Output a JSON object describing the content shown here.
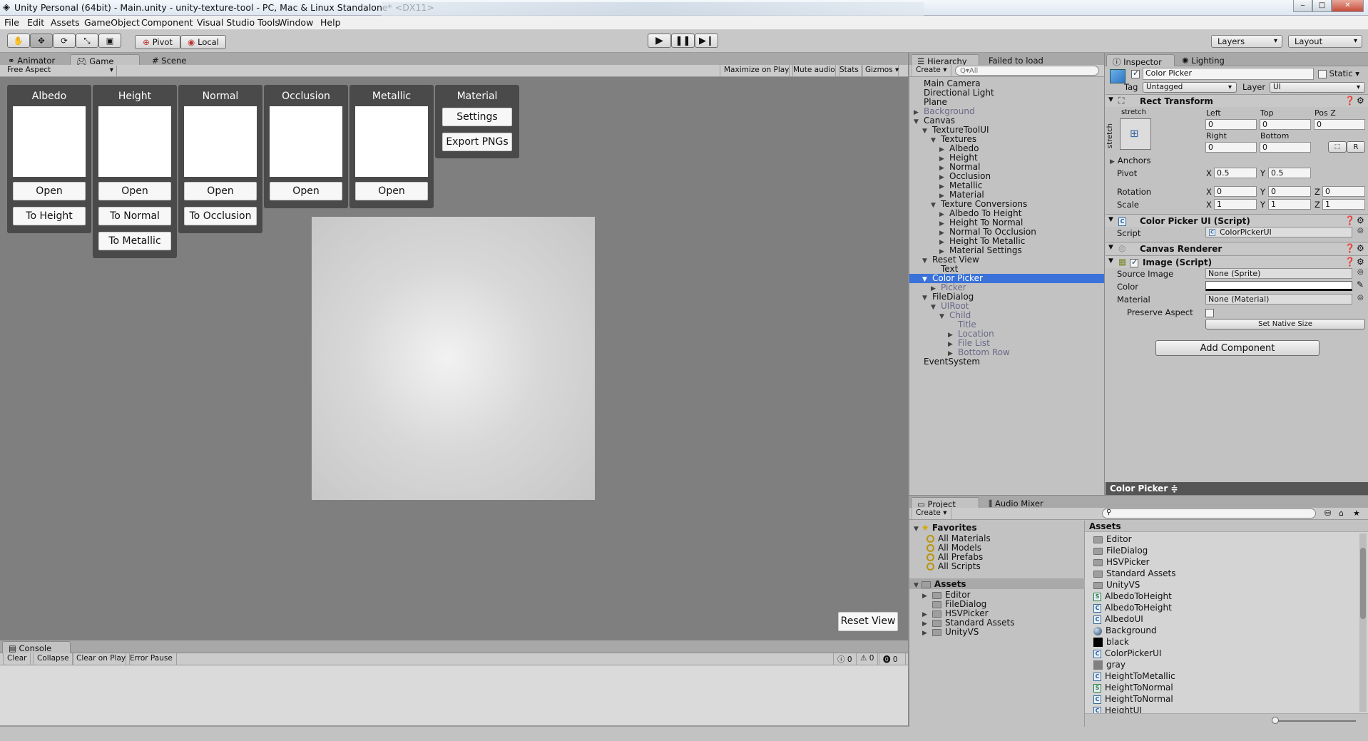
{
  "window": {
    "title": "Unity Personal (64bit) - Main.unity - unity-texture-tool - PC, Mac & Linux Standalone* <DX11>",
    "controls": [
      "‒",
      "□",
      "✕"
    ]
  },
  "menu": [
    "File",
    "Edit",
    "Assets",
    "GameObject",
    "Component",
    "Visual Studio Tools",
    "Window",
    "Help"
  ],
  "toolbar": {
    "pivot_label": "Pivot",
    "local_label": "Local",
    "layers_label": "Layers",
    "layout_label": "Layout"
  },
  "left_tabs": [
    "Animator",
    "Game",
    "Scene"
  ],
  "game_bar": {
    "aspect": "Free Aspect",
    "buttons": [
      "Maximize on Play",
      "Mute audio",
      "Stats",
      "Gizmos"
    ]
  },
  "game": {
    "panels": [
      {
        "label": "Albedo",
        "buttons": [
          "Open",
          "To Height"
        ]
      },
      {
        "label": "Height",
        "buttons": [
          "Open",
          "To Normal",
          "To Metallic"
        ]
      },
      {
        "label": "Normal",
        "buttons": [
          "Open",
          "To Occlusion"
        ]
      },
      {
        "label": "Occlusion",
        "buttons": [
          "Open"
        ]
      },
      {
        "label": "Metallic",
        "buttons": [
          "Open"
        ]
      },
      {
        "label": "Material",
        "buttons": [
          "Settings",
          "Export PNGs"
        ]
      }
    ],
    "reset_view": "Reset View"
  },
  "console": {
    "tab": "Console",
    "buttons": [
      "Clear",
      "Collapse",
      "Clear on Play",
      "Error Pause"
    ],
    "counts": [
      "0",
      "0",
      "0"
    ]
  },
  "hierarchy": {
    "tabs": [
      "Hierarchy",
      "Failed to load"
    ],
    "create": "Create",
    "search_placeholder": "Q▾All",
    "items": [
      {
        "label": "Main Camera",
        "depth": 0,
        "arrow": "",
        "dim": false
      },
      {
        "label": "Directional Light",
        "depth": 0,
        "arrow": "",
        "dim": false
      },
      {
        "label": "Plane",
        "depth": 0,
        "arrow": "",
        "dim": false
      },
      {
        "label": "Background",
        "depth": 0,
        "arrow": "▶",
        "dim": true
      },
      {
        "label": "Canvas",
        "depth": 0,
        "arrow": "▼",
        "dim": false
      },
      {
        "label": "TextureToolUI",
        "depth": 1,
        "arrow": "▼",
        "dim": false
      },
      {
        "label": "Textures",
        "depth": 2,
        "arrow": "▼",
        "dim": false
      },
      {
        "label": "Albedo",
        "depth": 3,
        "arrow": "▶",
        "dim": false
      },
      {
        "label": "Height",
        "depth": 3,
        "arrow": "▶",
        "dim": false
      },
      {
        "label": "Normal",
        "depth": 3,
        "arrow": "▶",
        "dim": false
      },
      {
        "label": "Occlusion",
        "depth": 3,
        "arrow": "▶",
        "dim": false
      },
      {
        "label": "Metallic",
        "depth": 3,
        "arrow": "▶",
        "dim": false
      },
      {
        "label": "Material",
        "depth": 3,
        "arrow": "▶",
        "dim": false
      },
      {
        "label": "Texture Conversions",
        "depth": 2,
        "arrow": "▼",
        "dim": false
      },
      {
        "label": "Albedo To Height",
        "depth": 3,
        "arrow": "▶",
        "dim": false
      },
      {
        "label": "Height To Normal",
        "depth": 3,
        "arrow": "▶",
        "dim": false
      },
      {
        "label": "Normal To Occlusion",
        "depth": 3,
        "arrow": "▶",
        "dim": false
      },
      {
        "label": "Height To Metallic",
        "depth": 3,
        "arrow": "▶",
        "dim": false
      },
      {
        "label": "Material Settings",
        "depth": 3,
        "arrow": "▶",
        "dim": false
      },
      {
        "label": "Reset View",
        "depth": 1,
        "arrow": "▼",
        "dim": false
      },
      {
        "label": "Text",
        "depth": 2,
        "arrow": "",
        "dim": false
      },
      {
        "label": "Color Picker",
        "depth": 1,
        "arrow": "▼",
        "dim": false,
        "selected": true
      },
      {
        "label": "Picker",
        "depth": 2,
        "arrow": "▶",
        "dim": true
      },
      {
        "label": "FileDialog",
        "depth": 1,
        "arrow": "▼",
        "dim": false
      },
      {
        "label": "UIRoot",
        "depth": 2,
        "arrow": "▼",
        "dim": true
      },
      {
        "label": "Child",
        "depth": 3,
        "arrow": "▼",
        "dim": true
      },
      {
        "label": "Title",
        "depth": 4,
        "arrow": "",
        "dim": true
      },
      {
        "label": "Location",
        "depth": 4,
        "arrow": "▶",
        "dim": true
      },
      {
        "label": "File List",
        "depth": 4,
        "arrow": "▶",
        "dim": true
      },
      {
        "label": "Bottom Row",
        "depth": 4,
        "arrow": "▶",
        "dim": true
      },
      {
        "label": "EventSystem",
        "depth": 0,
        "arrow": "",
        "dim": false
      }
    ]
  },
  "inspector": {
    "tabs": [
      "Inspector",
      "Lighting"
    ],
    "object_name": "Color Picker",
    "static_label": "Static",
    "tag_label": "Tag",
    "tag_value": "Untagged",
    "layer_label": "Layer",
    "layer_value": "UI",
    "rect_transform": {
      "title": "Rect Transform",
      "stretch_top": "stretch",
      "stretch_side": "stretch",
      "left_label": "Left",
      "left_value": "0",
      "top_label": "Top",
      "top_value": "0",
      "posz_label": "Pos Z",
      "posz_value": "0",
      "right_label": "Right",
      "right_value": "0",
      "bottom_label": "Bottom",
      "bottom_value": "0",
      "anchors_label": "Anchors",
      "pivot_label": "Pivot",
      "pivot_x": "0.5",
      "pivot_y": "0.5",
      "rotation_label": "Rotation",
      "rot_x": "0",
      "rot_y": "0",
      "rot_z": "0",
      "scale_label": "Scale",
      "scale_x": "1",
      "scale_y": "1",
      "scale_z": "1",
      "r_button": "R"
    },
    "color_picker_script": {
      "title": "Color Picker UI (Script)",
      "script_label": "Script",
      "script_value": "ColorPickerUI"
    },
    "canvas_renderer": {
      "title": "Canvas Renderer"
    },
    "image": {
      "title": "Image (Script)",
      "source_label": "Source Image",
      "source_value": "None (Sprite)",
      "color_label": "Color",
      "material_label": "Material",
      "material_value": "None (Material)",
      "preserve_label": "Preserve Aspect",
      "native_size": "Set Native Size"
    },
    "add_component": "Add Component",
    "footer": "Color Picker ≑"
  },
  "project": {
    "tabs": [
      "Project",
      "Audio Mixer"
    ],
    "create": "Create",
    "favorites_label": "Favorites",
    "favorites": [
      "All Materials",
      "All Models",
      "All Prefabs",
      "All Scripts"
    ],
    "assets_label": "Assets",
    "tree": [
      {
        "label": "Editor",
        "arrow": "▶"
      },
      {
        "label": "FileDialog",
        "arrow": ""
      },
      {
        "label": "HSVPicker",
        "arrow": "▶"
      },
      {
        "label": "Standard Assets",
        "arrow": "▶"
      },
      {
        "label": "UnityVS",
        "arrow": "▶"
      }
    ],
    "assets_header": "Assets",
    "assets": [
      {
        "label": "Editor",
        "kind": "folder"
      },
      {
        "label": "FileDialog",
        "kind": "folder"
      },
      {
        "label": "HSVPicker",
        "kind": "folder"
      },
      {
        "label": "Standard Assets",
        "kind": "folder"
      },
      {
        "label": "UnityVS",
        "kind": "folder"
      },
      {
        "label": "AlbedoToHeight",
        "kind": "script"
      },
      {
        "label": "AlbedoToHeight",
        "kind": "shader"
      },
      {
        "label": "AlbedoUI",
        "kind": "shader"
      },
      {
        "label": "Background",
        "kind": "material"
      },
      {
        "label": "black",
        "kind": "black"
      },
      {
        "label": "ColorPickerUI",
        "kind": "shader"
      },
      {
        "label": "gray",
        "kind": "gray"
      },
      {
        "label": "HeightToMetallic",
        "kind": "shader"
      },
      {
        "label": "HeightToNormal",
        "kind": "script"
      },
      {
        "label": "HeightToNormal",
        "kind": "shader"
      },
      {
        "label": "HeightUI",
        "kind": "shader"
      }
    ]
  },
  "colors": {
    "selection": "#3a72d9",
    "game_bg": "#7f7f7f",
    "panel_bg": "#4a4a4a"
  }
}
